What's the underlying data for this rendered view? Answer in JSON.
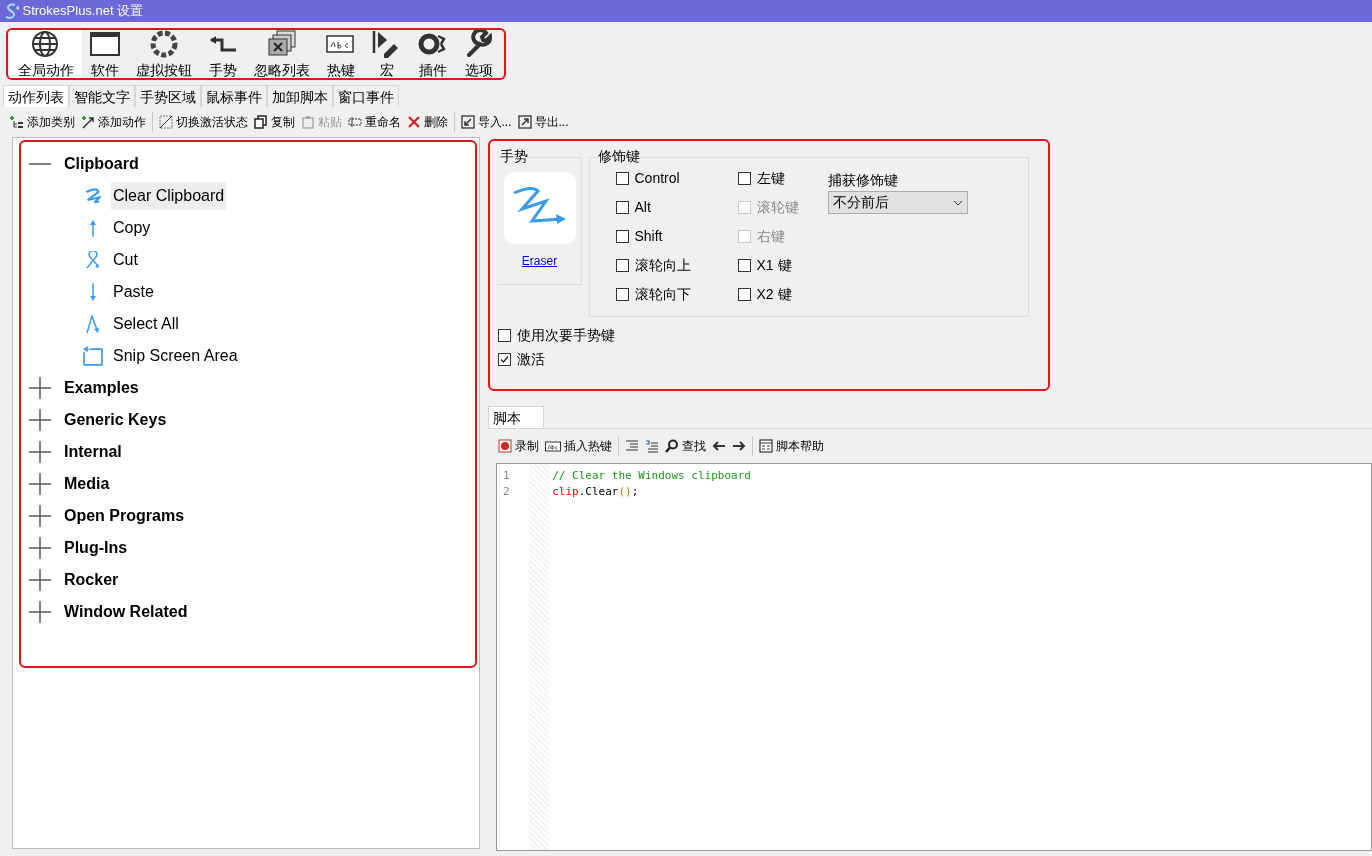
{
  "window": {
    "title": "StrokesPlus.net 设置"
  },
  "main_toolbar": {
    "highlighted": true,
    "items": [
      {
        "label": "全局动作",
        "kind": "globe",
        "selected": true
      },
      {
        "label": "软件",
        "kind": "window",
        "selected": false
      },
      {
        "label": "虚拟按钮",
        "kind": "ring",
        "selected": false
      },
      {
        "label": "手势",
        "kind": "turn",
        "selected": false
      },
      {
        "label": "忽略列表",
        "kind": "stack",
        "selected": false
      },
      {
        "label": "热键",
        "kind": "abc",
        "selected": false
      },
      {
        "label": "宏",
        "kind": "macro",
        "selected": false
      },
      {
        "label": "插件",
        "kind": "plugin",
        "selected": false
      },
      {
        "label": "选项",
        "kind": "wrench",
        "selected": false
      }
    ]
  },
  "tabs": [
    {
      "label": "动作列表",
      "selected": true
    },
    {
      "label": "智能文字",
      "selected": false
    },
    {
      "label": "手势区域",
      "selected": false
    },
    {
      "label": "鼠标事件",
      "selected": false
    },
    {
      "label": "加卸脚本",
      "selected": false
    },
    {
      "label": "窗口事件",
      "selected": false
    }
  ],
  "action_toolbar": [
    [
      {
        "label": "添加类别",
        "kind": "add-tree",
        "disabled": false
      },
      {
        "label": "添加动作",
        "kind": "add-arrow",
        "disabled": false
      }
    ],
    [
      {
        "label": "切换激活状态",
        "kind": "toggle",
        "disabled": false
      },
      {
        "label": "复制",
        "kind": "copy",
        "disabled": false
      },
      {
        "label": "粘贴",
        "kind": "paste",
        "disabled": true
      },
      {
        "label": "重命名",
        "kind": "rename",
        "disabled": false
      },
      {
        "label": "删除",
        "kind": "delete",
        "disabled": false
      }
    ],
    [
      {
        "label": "导入...",
        "kind": "import",
        "disabled": false
      },
      {
        "label": "导出...",
        "kind": "export",
        "disabled": false
      }
    ]
  ],
  "action_tree": {
    "highlighted": true,
    "categories": [
      {
        "label": "Clipboard",
        "expanded": true,
        "children": [
          {
            "label": "Clear Clipboard",
            "kind": "zigzag",
            "selected": true
          },
          {
            "label": "Copy",
            "kind": "up",
            "selected": false
          },
          {
            "label": "Cut",
            "kind": "loop",
            "selected": false
          },
          {
            "label": "Paste",
            "kind": "down",
            "selected": false
          },
          {
            "label": "Select All",
            "kind": "peak",
            "selected": false
          },
          {
            "label": "Snip Screen Area",
            "kind": "box",
            "selected": false
          }
        ]
      },
      {
        "label": "Examples",
        "expanded": false
      },
      {
        "label": "Generic Keys",
        "expanded": false
      },
      {
        "label": "Internal",
        "expanded": false
      },
      {
        "label": "Media",
        "expanded": false
      },
      {
        "label": "Open Programs",
        "expanded": false
      },
      {
        "label": "Plug-Ins",
        "expanded": false
      },
      {
        "label": "Rocker",
        "expanded": false
      },
      {
        "label": "Window Related",
        "expanded": false
      }
    ]
  },
  "gesture_panel": {
    "highlighted": true,
    "gesture": {
      "title": "手势",
      "name": "Eraser"
    },
    "modifiers": {
      "title": "修饰键",
      "columns": [
        [
          {
            "label": "Control",
            "checked": false,
            "disabled": false
          },
          {
            "label": "Alt",
            "checked": false,
            "disabled": false
          },
          {
            "label": "Shift",
            "checked": false,
            "disabled": false
          },
          {
            "label": "滚轮向上",
            "checked": false,
            "disabled": false
          },
          {
            "label": "滚轮向下",
            "checked": false,
            "disabled": false
          }
        ],
        [
          {
            "label": "左键",
            "checked": false,
            "disabled": false
          },
          {
            "label": "滚轮键",
            "checked": false,
            "disabled": true
          },
          {
            "label": "右键",
            "checked": false,
            "disabled": true
          },
          {
            "label": "X1 键",
            "checked": false,
            "disabled": false
          },
          {
            "label": "X2 键",
            "checked": false,
            "disabled": false
          }
        ]
      ],
      "capture_label": "捕获修饰键",
      "capture_value": "不分前后"
    },
    "options": [
      {
        "label": "使用次要手势键",
        "checked": false
      },
      {
        "label": "激活",
        "checked": true
      }
    ]
  },
  "script_tab": {
    "label": "脚本",
    "selected": true
  },
  "script_toolbar": [
    [
      {
        "label": "录制",
        "kind": "record"
      },
      {
        "label": "插入热键",
        "kind": "abc"
      }
    ],
    [
      {
        "kind": "indent"
      },
      {
        "kind": "comment"
      },
      {
        "label": "查找",
        "kind": "search"
      },
      {
        "kind": "back"
      },
      {
        "kind": "forward"
      }
    ],
    [
      {
        "label": "脚本帮助",
        "kind": "help"
      }
    ]
  ],
  "code": [
    {
      "number": "1",
      "tokens": [
        {
          "kind": "comment",
          "text": "// Clear the Windows clipboard"
        }
      ]
    },
    {
      "number": "2",
      "tokens": [
        {
          "kind": "object",
          "text": "clip"
        },
        {
          "kind": "plain",
          "text": ".Clear"
        },
        {
          "kind": "paren",
          "text": "()"
        },
        {
          "kind": "plain",
          "text": ";"
        }
      ]
    }
  ]
}
